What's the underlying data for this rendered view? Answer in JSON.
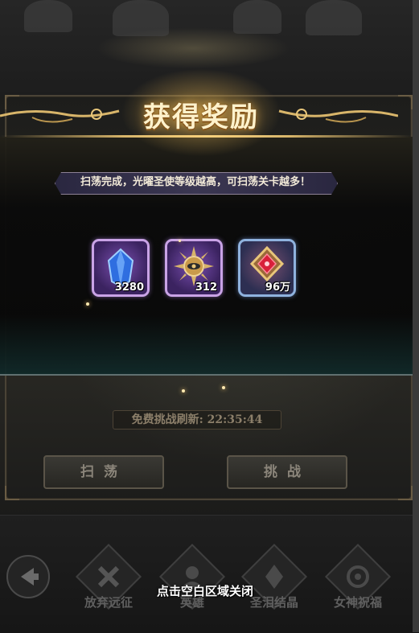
{
  "popup": {
    "title": "获得奖励",
    "subtitle": "扫荡完成，光曜圣使等级越高，可扫荡关卡越多！"
  },
  "rewards": [
    {
      "name": "blue-crystal-icon",
      "count": "3280",
      "frame": "purple"
    },
    {
      "name": "sun-emblem-icon",
      "count": "312",
      "frame": "purple"
    },
    {
      "name": "red-gem-icon",
      "count": "96万",
      "frame": "blue"
    }
  ],
  "panel": {
    "refresh_text": "免费挑战刷新: 22:35:44",
    "sweep_button": "扫荡",
    "challenge_button": "挑战"
  },
  "bottom_nav": {
    "items": [
      {
        "label": "放弃远征",
        "icon": "cross-icon"
      },
      {
        "label": "英雄",
        "icon": "hero-icon"
      },
      {
        "label": "圣泪结晶",
        "icon": "crystal-icon"
      },
      {
        "label": "女神祝福",
        "icon": "goddess-icon"
      }
    ],
    "back_icon": "back-arrow-icon"
  },
  "close_hint": "点击空白区域关闭",
  "colors": {
    "title": "#fff2cc",
    "gold_accent": "#d8b56a",
    "purple_frame": "#c9a3e6",
    "blue_frame": "#8fb2de"
  }
}
